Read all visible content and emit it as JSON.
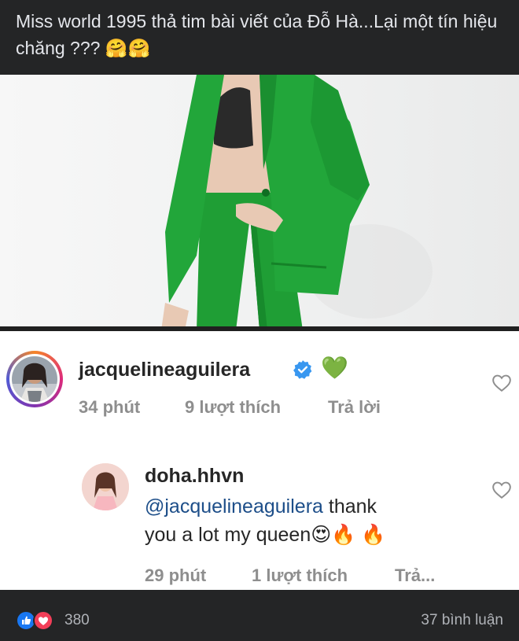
{
  "post": {
    "caption": "Miss world 1995 thả tim bài viết của Đỗ Hà...Lại một tín hiệu chăng ??? 🤗🤗"
  },
  "comments": [
    {
      "username": "jacquelineaguilera",
      "verified": true,
      "text_emoji": "💚",
      "time": "34 phút",
      "likes": "9 lượt thích",
      "reply": "Trả lời"
    },
    {
      "username": "doha.hhvn",
      "mention": "@jacquelineaguilera",
      "text_line1_rest": " thank",
      "text_line2": "you a lot my queen",
      "text_emojis": "😍🔥 🔥",
      "time": "29 phút",
      "likes": "1 lượt thích",
      "reply": "Trả..."
    }
  ],
  "footer": {
    "reaction_count": "380",
    "comment_count": "37 bình luận"
  },
  "colors": {
    "dark_bg": "#242526",
    "verified_blue": "#3897f0",
    "like_blue": "#1877f2",
    "love_red": "#f33e58",
    "suit_green": "#1f9e35"
  },
  "icons": {
    "verified": "verified-badge-icon",
    "heart": "heart-outline-icon",
    "like": "like-reaction-icon",
    "love": "love-reaction-icon"
  }
}
